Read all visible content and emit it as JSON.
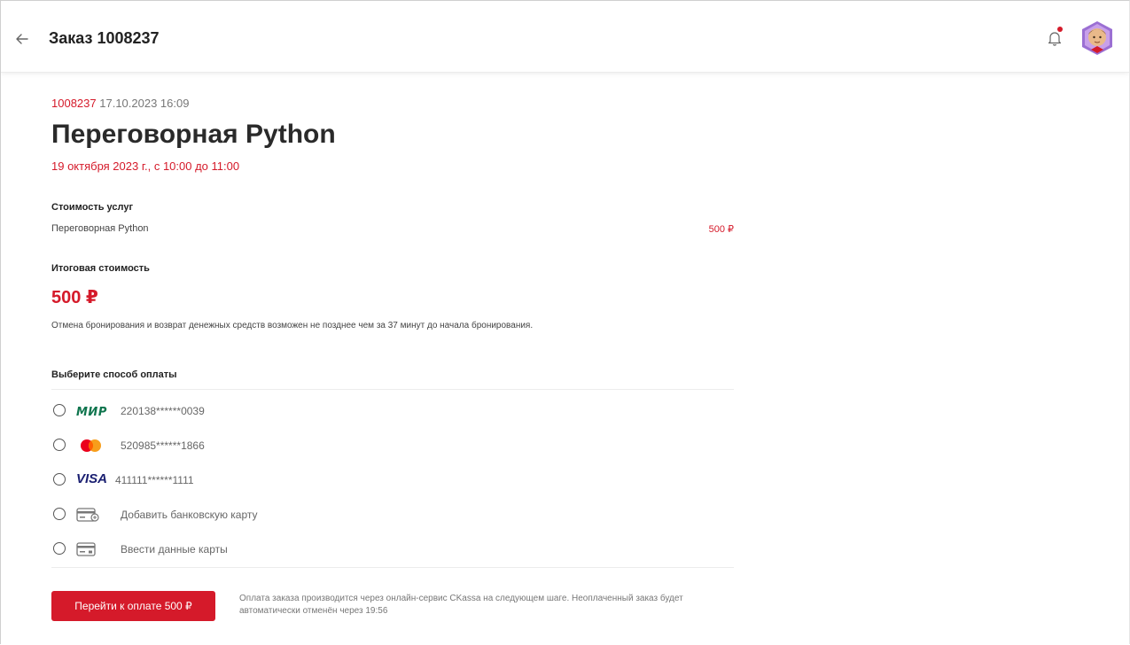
{
  "header": {
    "title": "Заказ 1008237"
  },
  "order": {
    "number": "1008237",
    "created_at": "17.10.2023 16:09",
    "room_title": "Переговорная Python",
    "booking_date": "19 октября 2023 г., с 10:00 до 11:00"
  },
  "services": {
    "label": "Стоимость услуг",
    "items": [
      {
        "name": "Переговорная Python",
        "price": "500 ₽"
      }
    ]
  },
  "total": {
    "label": "Итоговая стоимость",
    "value": "500 ₽"
  },
  "cancel_note": "Отмена бронирования и возврат денежных средств возможен не позднее чем за 37 минут до начала бронирования.",
  "payment": {
    "label": "Выберите способ оплаты",
    "methods": [
      {
        "icon": "mir-logo",
        "text": "220138******0039"
      },
      {
        "icon": "mastercard-logo",
        "text": "520985******1866"
      },
      {
        "icon": "visa-logo",
        "text": "411111******1111"
      },
      {
        "icon": "add-card-icon",
        "text": "Добавить банковскую карту"
      },
      {
        "icon": "card-icon",
        "text": "Ввести данные карты"
      }
    ],
    "mir_label": "МИР",
    "visa_label": "VISA",
    "button_label": "Перейти к оплате 500 ₽",
    "note": "Оплата заказа производится через онлайн-сервис CKassa на следующем шаге. Неоплаченный заказ будет автоматически отменён через 19:56"
  },
  "colors": {
    "accent": "#d51a2a",
    "mir_green": "#0f754e",
    "visa_blue": "#1a1f71",
    "mastercard_red": "#eb001b",
    "mastercard_orange": "#f79e1b"
  }
}
